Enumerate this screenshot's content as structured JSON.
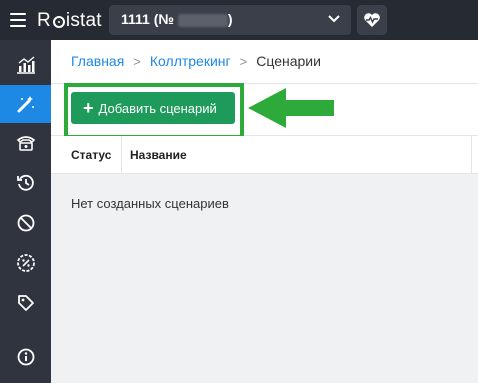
{
  "topbar": {
    "logo_text_pre": "R",
    "logo_text_post": "istat",
    "project_label": "1111 (№",
    "project_label_end": ")",
    "menu_icon": "hamburger-icon",
    "health_icon": "heart-pulse-icon"
  },
  "sidebar": {
    "items": [
      {
        "icon": "analytics-chart-icon"
      },
      {
        "icon": "magic-wand-icon",
        "active": true
      },
      {
        "icon": "telephone-icon"
      },
      {
        "icon": "history-icon"
      },
      {
        "icon": "blocked-icon"
      },
      {
        "icon": "percent-badge-icon"
      },
      {
        "icon": "tag-icon"
      },
      {
        "icon": "info-icon"
      }
    ],
    "active_color": "#1e88e5"
  },
  "breadcrumb": {
    "items": [
      "Главная",
      "Коллтрекинг",
      "Сценарии"
    ],
    "separator": ">"
  },
  "toolbar": {
    "add_button_label": "Добавить сценарий",
    "add_button_color": "#1e9b5b",
    "highlight_color": "#2eaa3a"
  },
  "table": {
    "columns": [
      "Статус",
      "Название"
    ],
    "empty_message": "Нет созданных сценариев"
  }
}
